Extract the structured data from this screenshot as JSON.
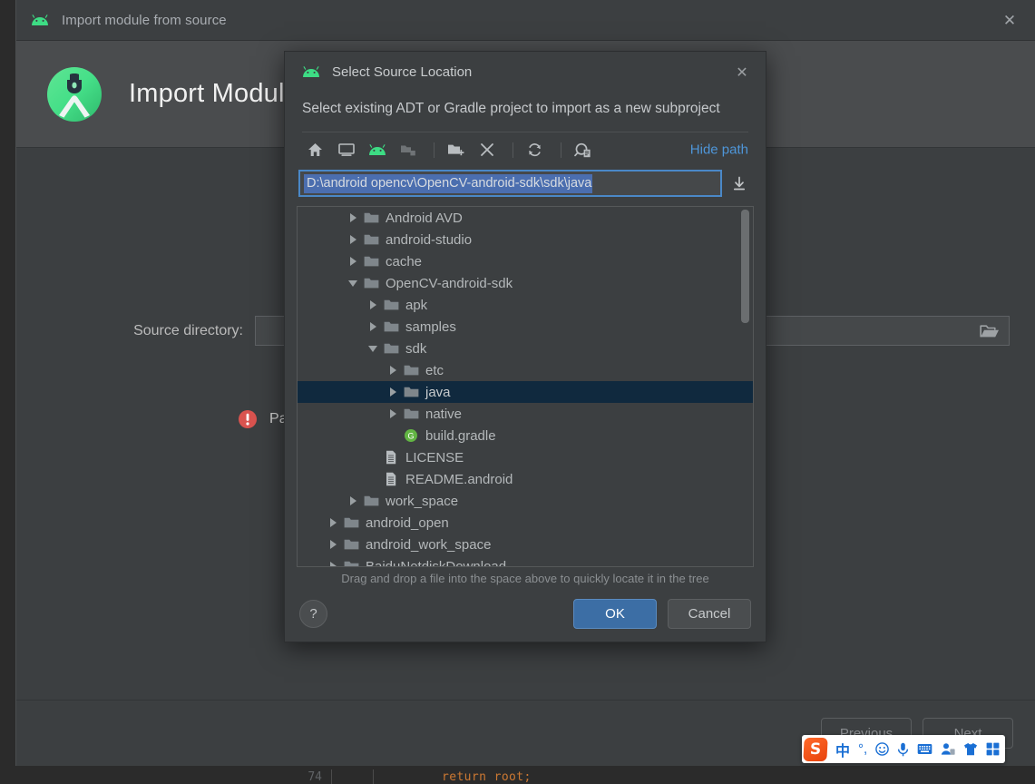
{
  "colors": {
    "background": "#3c3f41",
    "header_band": "#4a4c4e",
    "accent_blue": "#4e96d9",
    "primary_button": "#3c6ea5",
    "selection_row": "#10293e",
    "text_selection": "#4b6eaf",
    "android_green": "#3ddc84",
    "error_red": "#d9534f",
    "code_orange": "#cc7832"
  },
  "editor": {
    "line_number": "74",
    "code_text": "return root;"
  },
  "wizard": {
    "titlebar": {
      "icon": "android-icon",
      "title": "Import module from source",
      "close_label": "✕"
    },
    "header": {
      "icon": "android-studio-logo",
      "title": "Import Module fr"
    },
    "form": {
      "source_directory_label": "Source directory:",
      "source_directory_value": "",
      "source_directory_placeholder": "",
      "browse_icon": "folder-open-icon"
    },
    "validation": {
      "icon": "error-icon",
      "message": "Path is empty"
    },
    "footer": {
      "previous_label": "Previous",
      "next_label": "Next"
    }
  },
  "ime_bar": {
    "logo": "S",
    "items": [
      {
        "name": "chinese-mode-icon",
        "glyph": "中"
      },
      {
        "name": "punctuation-icon",
        "glyph": "°,"
      },
      {
        "name": "emoji-icon",
        "glyph": "☺"
      },
      {
        "name": "voice-input-icon",
        "glyph": "🎙"
      },
      {
        "name": "soft-keyboard-icon",
        "glyph": "⌨"
      },
      {
        "name": "user-icon",
        "glyph": "👤"
      },
      {
        "name": "skin-icon",
        "glyph": "👕"
      },
      {
        "name": "toolbox-icon",
        "glyph": "▦"
      }
    ]
  },
  "dialog": {
    "titlebar": {
      "icon": "android-icon",
      "title": "Select Source Location",
      "close_label": "✕"
    },
    "description": "Select existing ADT or Gradle project to import as a new subproject",
    "toolbar": {
      "buttons": [
        {
          "name": "home-icon",
          "title": "Home"
        },
        {
          "name": "desktop-icon",
          "title": "Desktop"
        },
        {
          "name": "android-home-icon",
          "title": "Android SDK"
        },
        {
          "name": "projects-icon",
          "title": "Projects"
        },
        {
          "name": "new-folder-icon",
          "title": "New Folder"
        },
        {
          "name": "delete-icon",
          "title": "Delete"
        },
        {
          "name": "refresh-icon",
          "title": "Refresh"
        },
        {
          "name": "show-hidden-icon",
          "title": "Show Hidden Files"
        }
      ],
      "hide_path_label": "Hide path"
    },
    "path_field": {
      "value": "D:\\android opencv\\OpenCV-android-sdk\\sdk\\java",
      "selected": true,
      "dropdown_icon": "download-history-icon"
    },
    "tree": {
      "rows": [
        {
          "label": "Android AVD",
          "indent": 2,
          "arrow": "right",
          "icon": "folder-icon",
          "selected": false
        },
        {
          "label": "android-studio",
          "indent": 2,
          "arrow": "right",
          "icon": "folder-icon",
          "selected": false
        },
        {
          "label": "cache",
          "indent": 2,
          "arrow": "right",
          "icon": "folder-icon",
          "selected": false
        },
        {
          "label": "OpenCV-android-sdk",
          "indent": 2,
          "arrow": "down",
          "icon": "folder-icon",
          "selected": false
        },
        {
          "label": "apk",
          "indent": 3,
          "arrow": "right",
          "icon": "folder-icon",
          "selected": false
        },
        {
          "label": "samples",
          "indent": 3,
          "arrow": "right",
          "icon": "folder-icon",
          "selected": false
        },
        {
          "label": "sdk",
          "indent": 3,
          "arrow": "down",
          "icon": "folder-icon",
          "selected": false
        },
        {
          "label": "etc",
          "indent": 4,
          "arrow": "right",
          "icon": "folder-icon",
          "selected": false
        },
        {
          "label": "java",
          "indent": 4,
          "arrow": "right",
          "icon": "folder-icon",
          "selected": true
        },
        {
          "label": "native",
          "indent": 4,
          "arrow": "right",
          "icon": "folder-icon",
          "selected": false
        },
        {
          "label": "build.gradle",
          "indent": 4,
          "arrow": "none",
          "icon": "gradle-icon",
          "selected": false
        },
        {
          "label": "LICENSE",
          "indent": 3,
          "arrow": "none",
          "icon": "file-icon",
          "selected": false
        },
        {
          "label": "README.android",
          "indent": 3,
          "arrow": "none",
          "icon": "file-icon",
          "selected": false
        },
        {
          "label": "work_space",
          "indent": 2,
          "arrow": "right",
          "icon": "folder-icon",
          "selected": false
        },
        {
          "label": "android_open",
          "indent": 1,
          "arrow": "right",
          "icon": "folder-icon",
          "selected": false
        },
        {
          "label": "android_work_space",
          "indent": 1,
          "arrow": "right",
          "icon": "folder-icon",
          "selected": false
        },
        {
          "label": "BaiduNetdiskDownload",
          "indent": 1,
          "arrow": "right",
          "icon": "folder-icon",
          "selected": false
        }
      ],
      "hint": "Drag and drop a file into the space above to quickly locate it in the tree",
      "scroll": {
        "top_pct": 10,
        "height_pct": 32
      }
    },
    "footer": {
      "help_label": "?",
      "ok_label": "OK",
      "cancel_label": "Cancel"
    }
  }
}
